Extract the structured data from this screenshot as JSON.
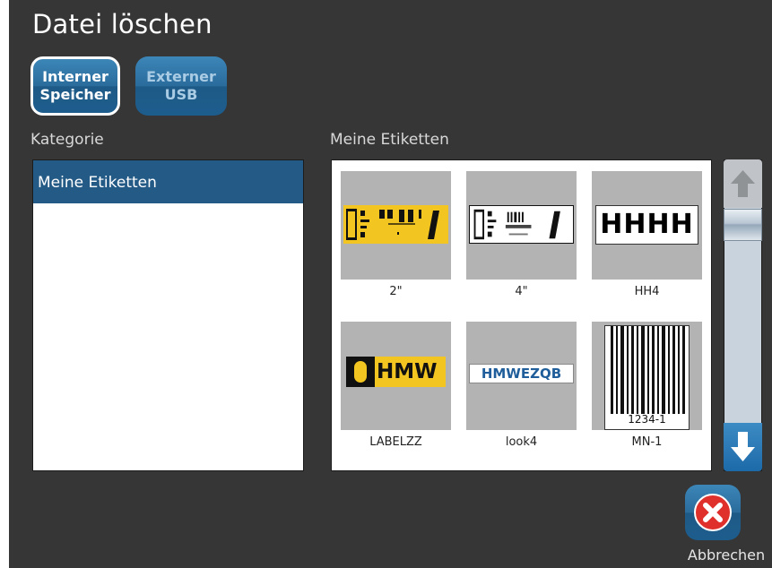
{
  "title": "Datei löschen",
  "sources": {
    "internal": "Interner\nSpeicher",
    "internal_line1": "Interner",
    "internal_line2": "Speicher",
    "external_line1": "Externer",
    "external_line2": "USB"
  },
  "category_panel": {
    "heading": "Kategorie",
    "items": [
      {
        "label": "Meine Etiketten",
        "selected": true
      }
    ]
  },
  "labels_panel": {
    "heading": "Meine Etiketten",
    "files": [
      {
        "name": "2\""
      },
      {
        "name": "4\""
      },
      {
        "name": "HH4",
        "preview_text": "HHHH"
      },
      {
        "name": "LABELZZ",
        "preview_text": "HMW"
      },
      {
        "name": "look4",
        "preview_text": "HMWEZQB"
      },
      {
        "name": "MN-1",
        "preview_text": "1234-1"
      }
    ]
  },
  "scroll": {
    "up_icon": "arrow-up-icon",
    "down_icon": "arrow-down-icon"
  },
  "cancel": {
    "label": "Abbrechen",
    "icon": "close-icon"
  },
  "colors": {
    "background": "#363636",
    "accent_blue": "#245a86",
    "button_blue": "#2a6c9c",
    "label_yellow": "#f3c520",
    "cancel_red": "#e0302b"
  }
}
